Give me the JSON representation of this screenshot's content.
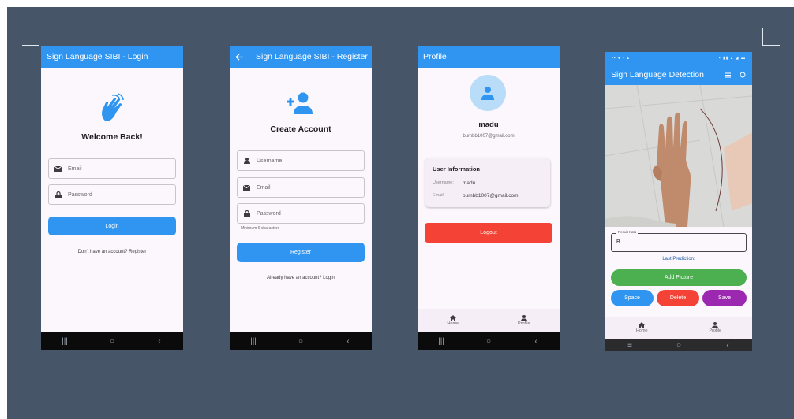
{
  "screens": {
    "login": {
      "appbar_title": "Sign Language SIBI - Login",
      "heading": "Welcome Back!",
      "email_placeholder": "Email",
      "password_placeholder": "Password",
      "login_label": "Login",
      "register_link": "Don't have an account? Register",
      "icon": "sign-language-hand-icon"
    },
    "register": {
      "appbar_title": "Sign Language SIBI - Register",
      "back_icon": "arrow-left-icon",
      "heading": "Create Account",
      "username_placeholder": "Username",
      "email_placeholder": "Email",
      "password_placeholder": "Password",
      "password_hint": "Minimum 6 characters",
      "register_label": "Register",
      "login_link": "Already have an account? Login",
      "icon": "person-add-icon"
    },
    "profile": {
      "appbar_title": "Profile",
      "name": "madu",
      "email": "bumbb1007@gmail.com",
      "info_title": "User Information",
      "username_label": "Username:",
      "username_value": "madu",
      "email_label": "Email:",
      "email_value": "bumbb1007@gmail.com",
      "logout_label": "Logout",
      "nav_home": "Home",
      "nav_profile": "Profile"
    },
    "detection": {
      "appbar_title": "Sign Language Detection",
      "result_label": "Result Kata",
      "result_value": "B",
      "last_prediction": "Last Prediction:",
      "add_picture_label": "Add Picture",
      "space_label": "Space",
      "delete_label": "Delete",
      "save_label": "Save",
      "nav_home": "Home",
      "nav_profile": "Profile"
    }
  },
  "system_nav": {
    "recents": "|||",
    "home": "○",
    "back": "‹"
  },
  "colors": {
    "background": "#475569",
    "primary": "#2f95f0",
    "logout": "#f44336",
    "add_picture": "#4caf50",
    "delete": "#f44336",
    "save": "#9c27b0",
    "space": "#2f95f0"
  }
}
